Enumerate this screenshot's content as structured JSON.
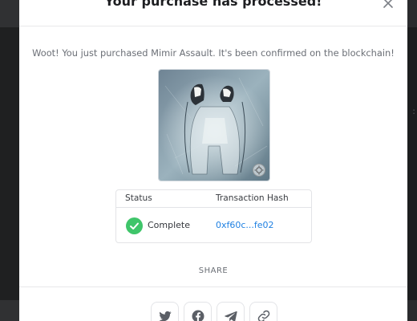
{
  "modal": {
    "title": "Your purchase has processed!",
    "message": "Woot! You just purchased Mimir Assault. It's been confirmed on the blockchain!",
    "close_icon": "close-icon"
  },
  "artwork": {
    "item_name": "Mimir Assault",
    "zoom_icon": "expand-icon"
  },
  "status_table": {
    "headers": {
      "status": "Status",
      "hash": "Transaction Hash"
    },
    "row": {
      "status": "Complete",
      "hash": "0xf60c...fe02",
      "status_icon": "check-circle-icon"
    }
  },
  "share": {
    "label": "SHARE",
    "buttons": [
      {
        "icon": "twitter-icon"
      },
      {
        "icon": "facebook-icon"
      },
      {
        "icon": "telegram-icon"
      },
      {
        "icon": "link-icon"
      }
    ]
  },
  "colors": {
    "accent_link": "#2081e2",
    "success": "#3fc56a",
    "title": "#1e1f22",
    "muted": "#6b6f76"
  }
}
